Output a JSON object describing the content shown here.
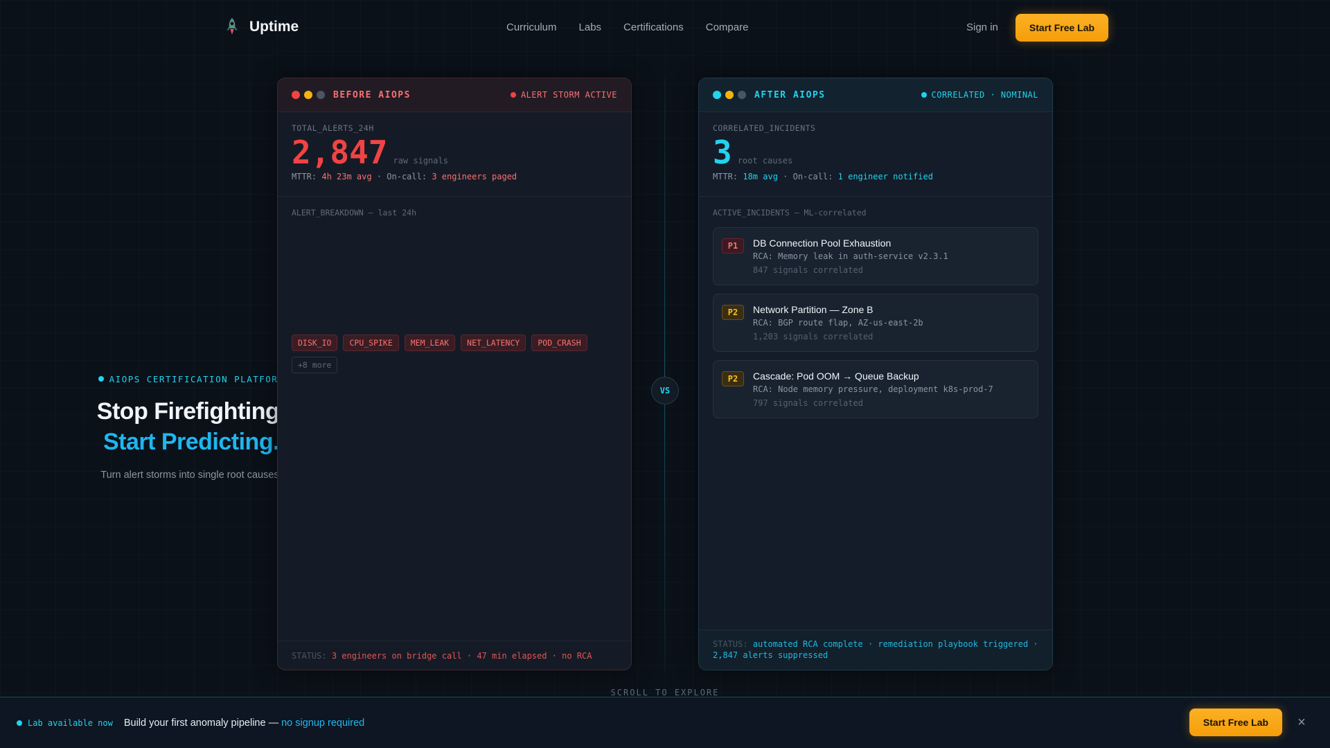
{
  "nav": {
    "brand": "Uptime",
    "links": [
      "Curriculum",
      "Labs",
      "Certifications",
      "Compare"
    ],
    "signin": "Sign in",
    "cta": "Start Free Lab"
  },
  "hero": {
    "eyebrow": "AIOPS CERTIFICATION PLATFORM",
    "title_line1": "Stop Firefighting.",
    "title_line2": "Start Predicting.",
    "subtitle": "Turn alert storms into single root causes."
  },
  "before": {
    "title": "BEFORE AIOPS",
    "status": "ALERT STORM ACTIVE",
    "metric_label": "TOTAL_ALERTS_24H",
    "metric_value": "2,847",
    "metric_unit": "raw signals",
    "mttr_label": "MTTR:",
    "mttr_value": "4h 23m avg",
    "oncall_label": " · On-call:",
    "oncall_value": "3 engineers paged",
    "section_label": "ALERT_BREAKDOWN — last 24h",
    "tags": [
      "DISK_IO",
      "CPU_SPIKE",
      "MEM_LEAK",
      "NET_LATENCY",
      "POD_CRASH"
    ],
    "more_tag": "+8 more",
    "footer_label": "STATUS:",
    "footer_value": "3 engineers on bridge call · 47 min elapsed · no RCA"
  },
  "after": {
    "title": "AFTER AIOPS",
    "status": "CORRELATED · NOMINAL",
    "metric_label": "CORRELATED_INCIDENTS",
    "metric_value": "3",
    "metric_unit": "root causes",
    "mttr_label": "MTTR:",
    "mttr_value": "18m avg",
    "oncall_label": " · On-call:",
    "oncall_value": "1 engineer notified",
    "section_label": "ACTIVE_INCIDENTS — ML-correlated",
    "incidents": [
      {
        "priority": "P1",
        "title": "DB Connection Pool Exhaustion",
        "rca": "RCA: Memory leak in auth-service v2.3.1",
        "count": "847 signals correlated"
      },
      {
        "priority": "P2",
        "title": "Network Partition — Zone B",
        "rca": "RCA: BGP route flap, AZ-us-east-2b",
        "count": "1,203 signals correlated"
      },
      {
        "priority": "P2",
        "title": "Cascade: Pod OOM → Queue Backup",
        "rca": "RCA: Node memory pressure, deployment k8s-prod-7",
        "count": "797 signals correlated"
      }
    ],
    "footer_label": "STATUS:",
    "footer_value": "automated RCA complete · remediation playbook triggered · 2,847 alerts suppressed"
  },
  "vs": "VS",
  "scroll_hint": "SCROLL TO EXPLORE",
  "bottom_bar": {
    "badge": "Lab available now",
    "text": "Build your first anomaly pipeline — ",
    "link": "no signup required",
    "cta": "Start Free Lab",
    "close": "×"
  },
  "colors": {
    "accent_cyan": "#22d3ee",
    "accent_amber": "#f59e0b",
    "alert_red": "#f04444",
    "background": "#0b1119"
  },
  "icons": {
    "brand": "rocket-logo-icon",
    "close": "close-icon"
  }
}
